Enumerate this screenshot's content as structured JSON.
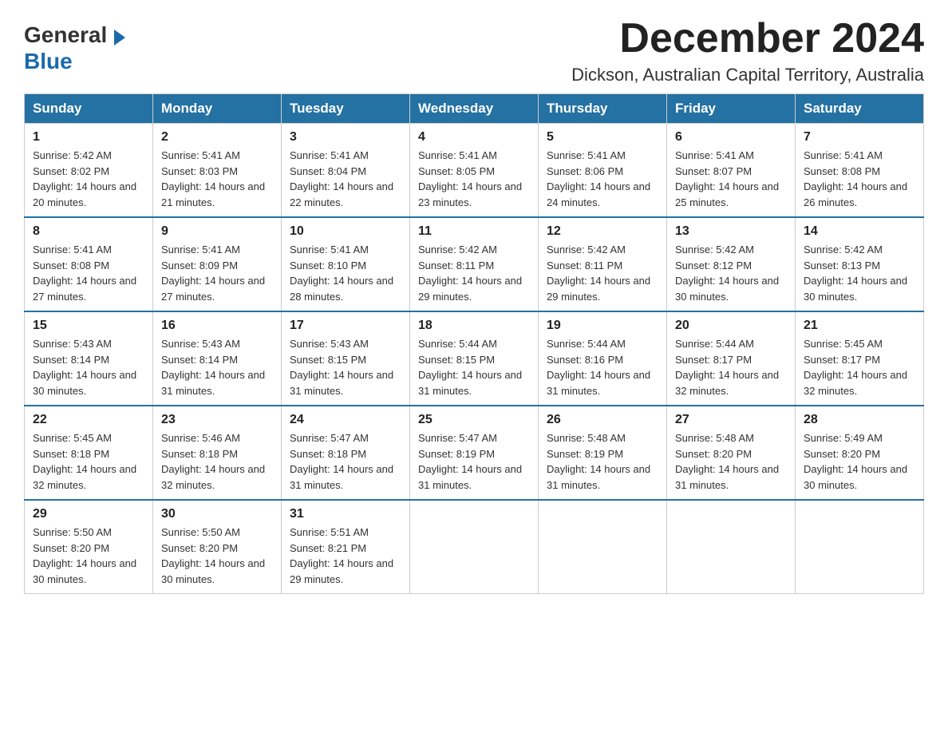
{
  "header": {
    "logo_general": "General",
    "logo_blue": "Blue",
    "month_title": "December 2024",
    "location": "Dickson, Australian Capital Territory, Australia"
  },
  "calendar": {
    "days_of_week": [
      "Sunday",
      "Monday",
      "Tuesday",
      "Wednesday",
      "Thursday",
      "Friday",
      "Saturday"
    ],
    "weeks": [
      [
        {
          "day": "1",
          "sunrise": "5:42 AM",
          "sunset": "8:02 PM",
          "daylight": "14 hours and 20 minutes."
        },
        {
          "day": "2",
          "sunrise": "5:41 AM",
          "sunset": "8:03 PM",
          "daylight": "14 hours and 21 minutes."
        },
        {
          "day": "3",
          "sunrise": "5:41 AM",
          "sunset": "8:04 PM",
          "daylight": "14 hours and 22 minutes."
        },
        {
          "day": "4",
          "sunrise": "5:41 AM",
          "sunset": "8:05 PM",
          "daylight": "14 hours and 23 minutes."
        },
        {
          "day": "5",
          "sunrise": "5:41 AM",
          "sunset": "8:06 PM",
          "daylight": "14 hours and 24 minutes."
        },
        {
          "day": "6",
          "sunrise": "5:41 AM",
          "sunset": "8:07 PM",
          "daylight": "14 hours and 25 minutes."
        },
        {
          "day": "7",
          "sunrise": "5:41 AM",
          "sunset": "8:08 PM",
          "daylight": "14 hours and 26 minutes."
        }
      ],
      [
        {
          "day": "8",
          "sunrise": "5:41 AM",
          "sunset": "8:08 PM",
          "daylight": "14 hours and 27 minutes."
        },
        {
          "day": "9",
          "sunrise": "5:41 AM",
          "sunset": "8:09 PM",
          "daylight": "14 hours and 27 minutes."
        },
        {
          "day": "10",
          "sunrise": "5:41 AM",
          "sunset": "8:10 PM",
          "daylight": "14 hours and 28 minutes."
        },
        {
          "day": "11",
          "sunrise": "5:42 AM",
          "sunset": "8:11 PM",
          "daylight": "14 hours and 29 minutes."
        },
        {
          "day": "12",
          "sunrise": "5:42 AM",
          "sunset": "8:11 PM",
          "daylight": "14 hours and 29 minutes."
        },
        {
          "day": "13",
          "sunrise": "5:42 AM",
          "sunset": "8:12 PM",
          "daylight": "14 hours and 30 minutes."
        },
        {
          "day": "14",
          "sunrise": "5:42 AM",
          "sunset": "8:13 PM",
          "daylight": "14 hours and 30 minutes."
        }
      ],
      [
        {
          "day": "15",
          "sunrise": "5:43 AM",
          "sunset": "8:14 PM",
          "daylight": "14 hours and 30 minutes."
        },
        {
          "day": "16",
          "sunrise": "5:43 AM",
          "sunset": "8:14 PM",
          "daylight": "14 hours and 31 minutes."
        },
        {
          "day": "17",
          "sunrise": "5:43 AM",
          "sunset": "8:15 PM",
          "daylight": "14 hours and 31 minutes."
        },
        {
          "day": "18",
          "sunrise": "5:44 AM",
          "sunset": "8:15 PM",
          "daylight": "14 hours and 31 minutes."
        },
        {
          "day": "19",
          "sunrise": "5:44 AM",
          "sunset": "8:16 PM",
          "daylight": "14 hours and 31 minutes."
        },
        {
          "day": "20",
          "sunrise": "5:44 AM",
          "sunset": "8:17 PM",
          "daylight": "14 hours and 32 minutes."
        },
        {
          "day": "21",
          "sunrise": "5:45 AM",
          "sunset": "8:17 PM",
          "daylight": "14 hours and 32 minutes."
        }
      ],
      [
        {
          "day": "22",
          "sunrise": "5:45 AM",
          "sunset": "8:18 PM",
          "daylight": "14 hours and 32 minutes."
        },
        {
          "day": "23",
          "sunrise": "5:46 AM",
          "sunset": "8:18 PM",
          "daylight": "14 hours and 32 minutes."
        },
        {
          "day": "24",
          "sunrise": "5:47 AM",
          "sunset": "8:18 PM",
          "daylight": "14 hours and 31 minutes."
        },
        {
          "day": "25",
          "sunrise": "5:47 AM",
          "sunset": "8:19 PM",
          "daylight": "14 hours and 31 minutes."
        },
        {
          "day": "26",
          "sunrise": "5:48 AM",
          "sunset": "8:19 PM",
          "daylight": "14 hours and 31 minutes."
        },
        {
          "day": "27",
          "sunrise": "5:48 AM",
          "sunset": "8:20 PM",
          "daylight": "14 hours and 31 minutes."
        },
        {
          "day": "28",
          "sunrise": "5:49 AM",
          "sunset": "8:20 PM",
          "daylight": "14 hours and 30 minutes."
        }
      ],
      [
        {
          "day": "29",
          "sunrise": "5:50 AM",
          "sunset": "8:20 PM",
          "daylight": "14 hours and 30 minutes."
        },
        {
          "day": "30",
          "sunrise": "5:50 AM",
          "sunset": "8:20 PM",
          "daylight": "14 hours and 30 minutes."
        },
        {
          "day": "31",
          "sunrise": "5:51 AM",
          "sunset": "8:21 PM",
          "daylight": "14 hours and 29 minutes."
        },
        null,
        null,
        null,
        null
      ]
    ]
  }
}
